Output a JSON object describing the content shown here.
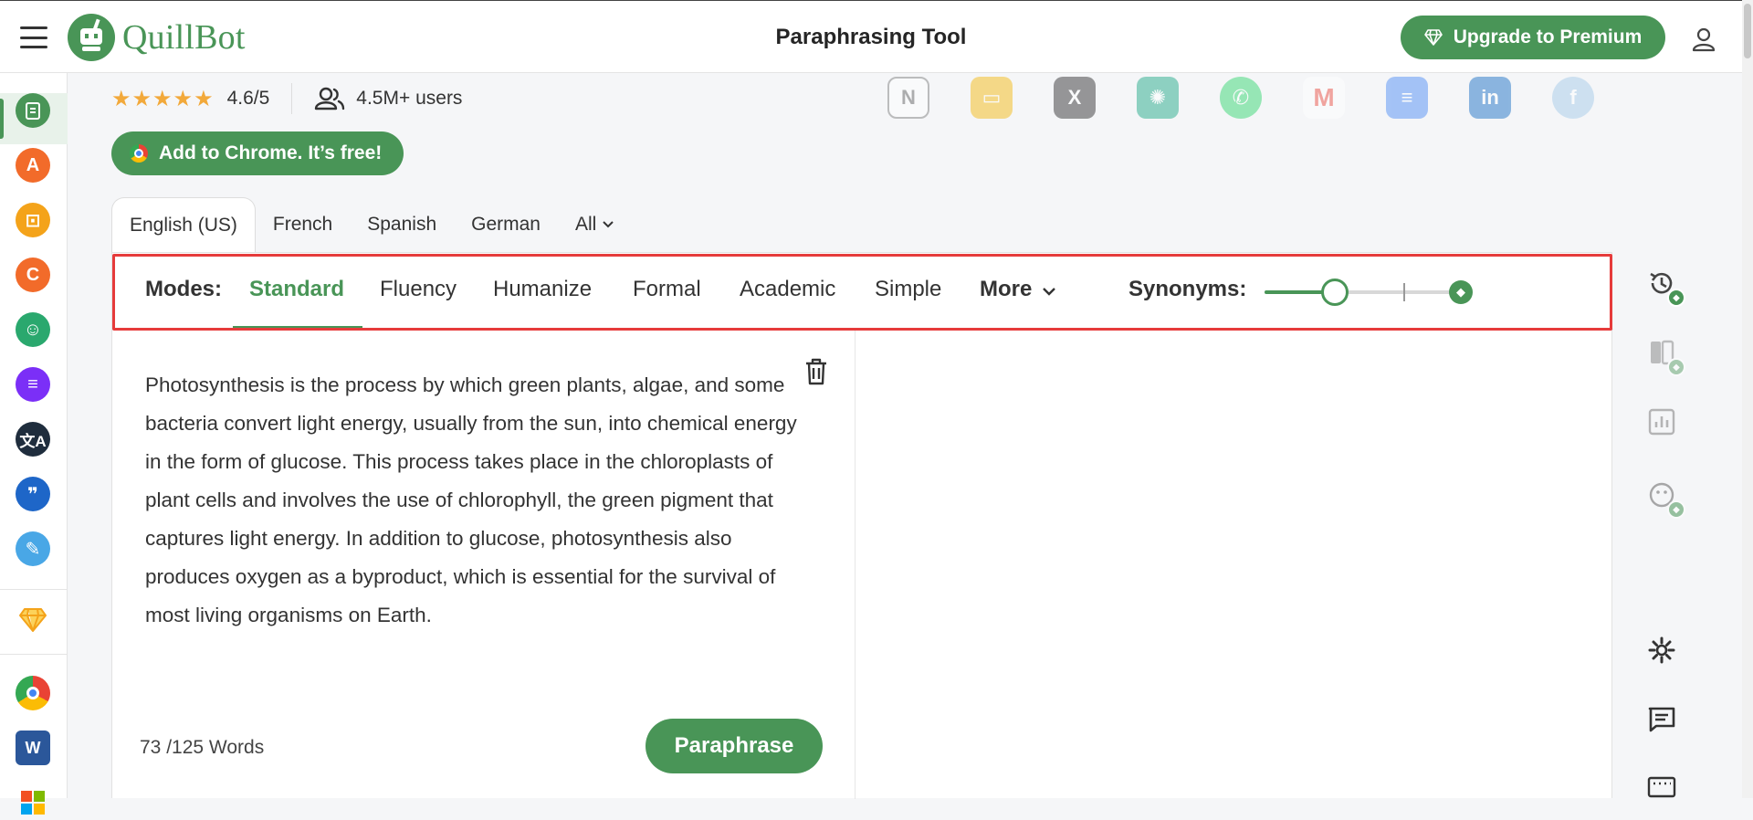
{
  "header": {
    "logo_text": "QuillBot",
    "page_title": "Paraphrasing Tool",
    "upgrade_label": "Upgrade to Premium"
  },
  "sidebar": {
    "items": [
      {
        "icon": "paraphraser-icon",
        "color": "#499557",
        "active": true
      },
      {
        "icon": "grammar-checker-icon",
        "color": "#f26b2a"
      },
      {
        "icon": "ai-detector-icon",
        "color": "#f4a31a"
      },
      {
        "icon": "plagiarism-checker-icon",
        "color": "#f26b2a"
      },
      {
        "icon": "humanizer-icon",
        "color": "#2aa86e"
      },
      {
        "icon": "summarizer-icon",
        "color": "#7b2ff7"
      },
      {
        "icon": "translator-icon",
        "color": "#1f2d3d"
      },
      {
        "icon": "citation-generator-icon",
        "color": "#1e66c8"
      },
      {
        "icon": "quillbot-flow-icon",
        "color": "#49a7e6"
      },
      {
        "icon": "premium-diamond-icon",
        "color": "#f4a31a"
      },
      {
        "icon": "chrome-extension-icon",
        "color": "#4285f4"
      },
      {
        "icon": "word-addin-icon",
        "color": "#2b579a"
      },
      {
        "icon": "windows-app-icon",
        "color": "#f25022"
      }
    ]
  },
  "stats": {
    "stars": "★★★★★",
    "rating": "4.6/5",
    "users": "4.5M+ users"
  },
  "integrations": [
    {
      "icon": "notion-icon",
      "glyph": "N",
      "color": "#9a9a9a"
    },
    {
      "icon": "google-slides-icon",
      "glyph": "▭",
      "color": "#f4b400"
    },
    {
      "icon": "x-twitter-icon",
      "glyph": "X",
      "color": "#222"
    },
    {
      "icon": "chatgpt-icon",
      "glyph": "✺",
      "color": "#10a37f"
    },
    {
      "icon": "whatsapp-icon",
      "glyph": "✆",
      "color": "#25d366"
    },
    {
      "icon": "gmail-icon",
      "glyph": "M",
      "color": "#ea4335"
    },
    {
      "icon": "google-docs-icon",
      "glyph": "≡",
      "color": "#4285f4"
    },
    {
      "icon": "linkedin-icon",
      "glyph": "in",
      "color": "#0a66c2"
    },
    {
      "icon": "facebook-icon",
      "glyph": "f",
      "color": "#9ec7e8"
    }
  ],
  "chrome_cta": "Add to Chrome. It’s free!",
  "languages": {
    "tabs": [
      "English (US)",
      "French",
      "Spanish",
      "German"
    ],
    "all_label": "All",
    "active": "English (US)"
  },
  "modes": {
    "label": "Modes:",
    "items": [
      "Standard",
      "Fluency",
      "Humanize",
      "Formal",
      "Academic",
      "Simple"
    ],
    "active": "Standard",
    "more_label": "More",
    "synonyms_label": "Synonyms:",
    "synonyms_level": 0.33
  },
  "input": {
    "text": "Photosynthesis is the process by which green plants, algae, and some bacteria convert light energy, usually from the sun, into chemical energy in the form of glucose. This process takes place in the chloroplasts of plant cells and involves the use of chlorophyll, the green pigment that captures light energy. In addition to glucose, photosynthesis also produces oxygen as a byproduct, which is essential for the survival of most living organisms on Earth.",
    "word_count": "73 /125 Words",
    "paraphrase_label": "Paraphrase"
  },
  "right_rail": [
    {
      "icon": "history-icon",
      "premium": true
    },
    {
      "icon": "compare-modes-icon",
      "premium": true
    },
    {
      "icon": "statistics-icon",
      "premium": false
    },
    {
      "icon": "tone-icon",
      "premium": true
    },
    {
      "icon": "settings-gear-icon",
      "premium": false
    },
    {
      "icon": "feedback-icon",
      "premium": false
    },
    {
      "icon": "keyboard-shortcuts-icon",
      "premium": false
    }
  ]
}
